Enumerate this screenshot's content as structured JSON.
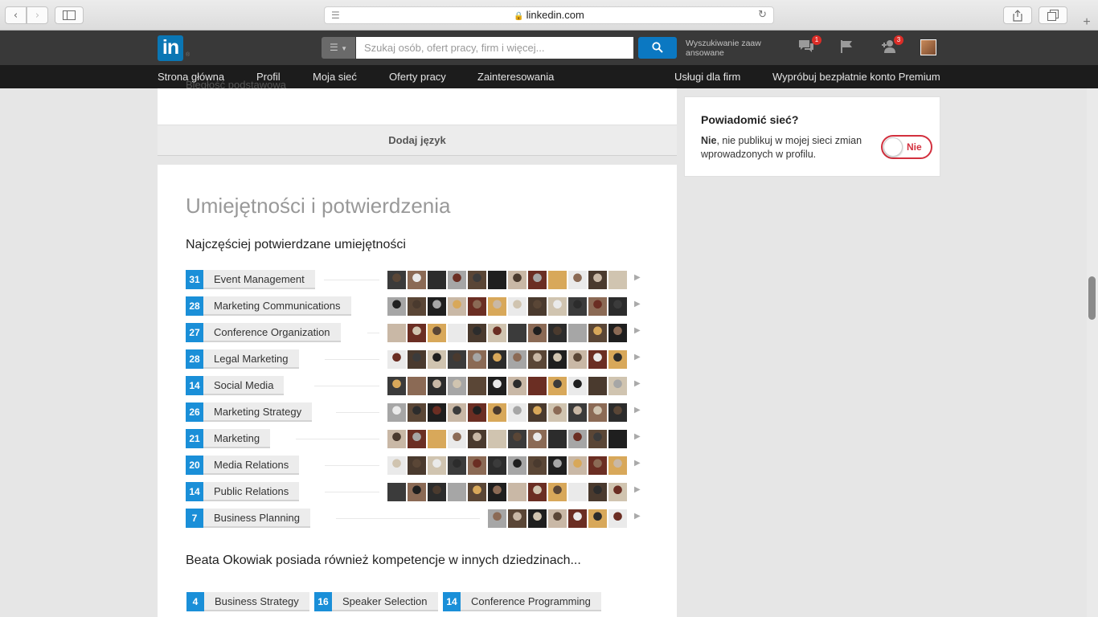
{
  "browser": {
    "url": "linkedin.com",
    "back_icon": "‹",
    "forward_icon": "›",
    "new_tab_icon": "+"
  },
  "linkedin": {
    "logo": "in",
    "logo_reg": "®",
    "search_placeholder": "Szukaj osób, ofert pracy, firm i więcej...",
    "advanced_search": "Wyszukiwanie zaaw ansowane",
    "messages_badge": "1",
    "invitations_badge": "3",
    "nav": {
      "home": "Strona główna",
      "profile": "Profil",
      "network": "Moja sieć",
      "jobs": "Oferty pracy",
      "interests": "Zainteresowania",
      "business": "Usługi dla firm",
      "premium": "Wypróbuj bezpłatnie konto Premium"
    }
  },
  "languages": {
    "cut_text": "Biegłość podstawowa",
    "add_language": "Dodaj język"
  },
  "skills": {
    "title": "Umiejętności i potwierdzenia",
    "top_heading": "Najczęściej potwierdzane umiejętności",
    "items": [
      {
        "count": "31",
        "name": "Event Management",
        "faces": 12
      },
      {
        "count": "28",
        "name": "Marketing Communications",
        "faces": 12
      },
      {
        "count": "27",
        "name": "Conference Organization",
        "faces": 12
      },
      {
        "count": "28",
        "name": "Legal Marketing",
        "faces": 12
      },
      {
        "count": "14",
        "name": "Social Media",
        "faces": 12
      },
      {
        "count": "26",
        "name": "Marketing Strategy",
        "faces": 12
      },
      {
        "count": "21",
        "name": "Marketing",
        "faces": 12
      },
      {
        "count": "20",
        "name": "Media Relations",
        "faces": 12
      },
      {
        "count": "14",
        "name": "Public Relations",
        "faces": 12
      },
      {
        "count": "7",
        "name": "Business Planning",
        "faces": 7
      }
    ],
    "other_heading": "Beata Okowiak posiada również kompetencje w innych dziedzinach...",
    "other": [
      {
        "count": "4",
        "name": "Business Strategy"
      },
      {
        "count": "16",
        "name": "Speaker Selection"
      },
      {
        "count": "14",
        "name": "Conference Programming"
      }
    ]
  },
  "notify": {
    "title": "Powiadomić sieć?",
    "text_bold": "Nie",
    "text_rest": ", nie publikuj w mojej sieci zmian wprowadzonych w profilu.",
    "toggle_label": "Nie"
  }
}
